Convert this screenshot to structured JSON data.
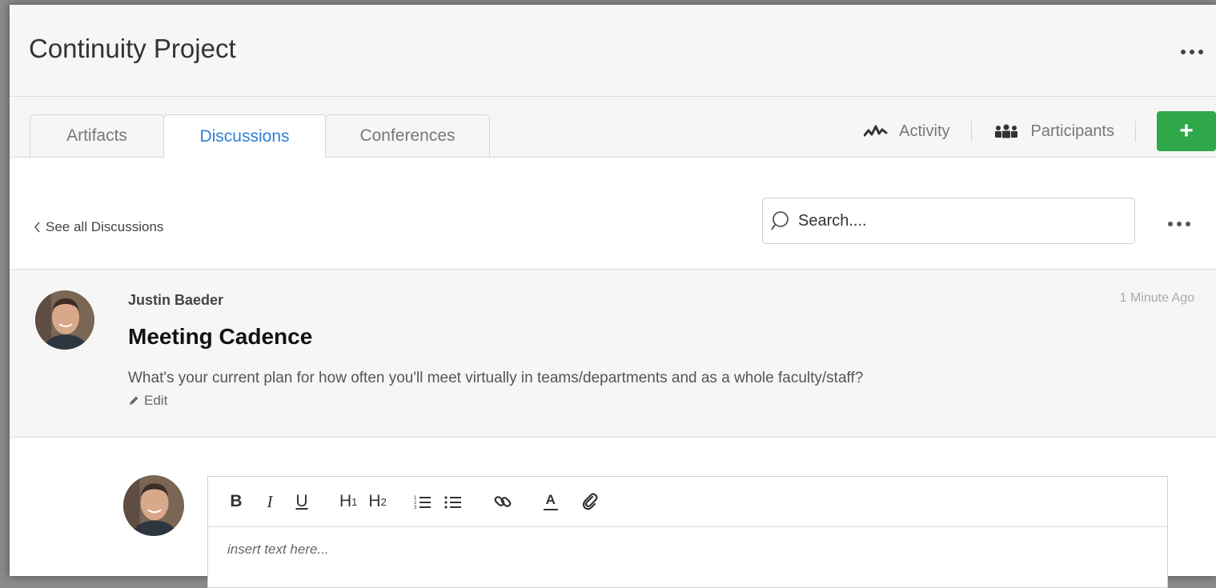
{
  "header": {
    "title": "Continuity Project"
  },
  "tabs": [
    {
      "label": "Artifacts",
      "active": false
    },
    {
      "label": "Discussions",
      "active": true
    },
    {
      "label": "Conferences",
      "active": false
    }
  ],
  "nav": {
    "activity_label": "Activity",
    "participants_label": "Participants",
    "add_label": "+"
  },
  "subnav": {
    "back_label": "See all Discussions",
    "search_placeholder": "Search...."
  },
  "post": {
    "author": "Justin Baeder",
    "time": "1 Minute Ago",
    "title": "Meeting Cadence",
    "body": "What's your current plan for how often you'll meet virtually in teams/departments and as a whole faculty/staff?",
    "edit_label": "Edit"
  },
  "editor": {
    "placeholder": "insert text here...",
    "toolbar": [
      "bold",
      "italic",
      "underline",
      "heading-1",
      "heading-2",
      "ordered-list",
      "bullet-list",
      "link",
      "text-color",
      "attachment"
    ]
  },
  "colors": {
    "accent": "#2d7fd6",
    "add_button": "#2fa84a"
  }
}
